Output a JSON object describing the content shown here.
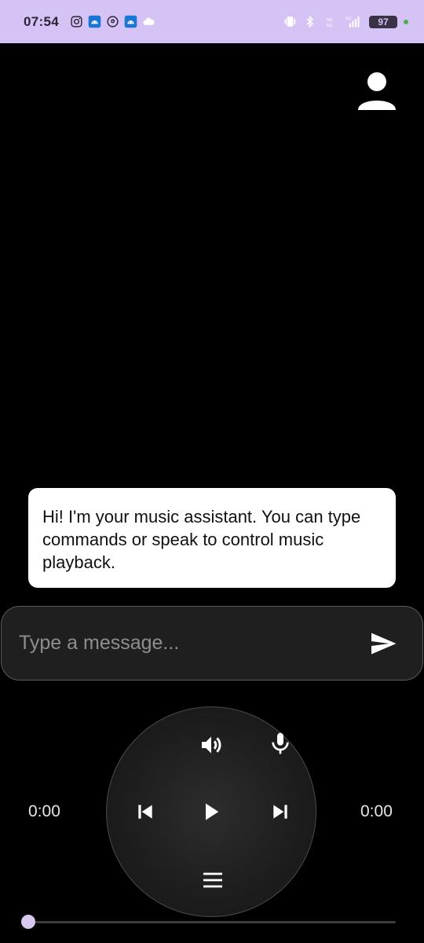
{
  "status_bar": {
    "time": "07:54",
    "battery": "97",
    "network": "5G",
    "icons": [
      "instagram-icon",
      "android-icon",
      "threads-icon",
      "android-icon",
      "cloud-icon",
      "vibrate-icon",
      "bluetooth-icon",
      "volte-icon",
      "signal-icon",
      "battery-icon"
    ],
    "background": "#d5c3f5"
  },
  "assistant": {
    "message": "Hi! I'm your music assistant. You can type commands or speak to control music playback."
  },
  "input": {
    "placeholder": "Type a message...",
    "value": ""
  },
  "player": {
    "elapsed": "0:00",
    "duration": "0:00",
    "progress": 0,
    "controls": [
      "volume-icon",
      "microphone-icon",
      "previous-icon",
      "play-icon",
      "next-icon",
      "menu-icon"
    ]
  },
  "colors": {
    "background": "#000000",
    "bubble": "#ffffff",
    "input_bg": "#1f1f1f",
    "seek_thumb": "#d6c8ef"
  }
}
